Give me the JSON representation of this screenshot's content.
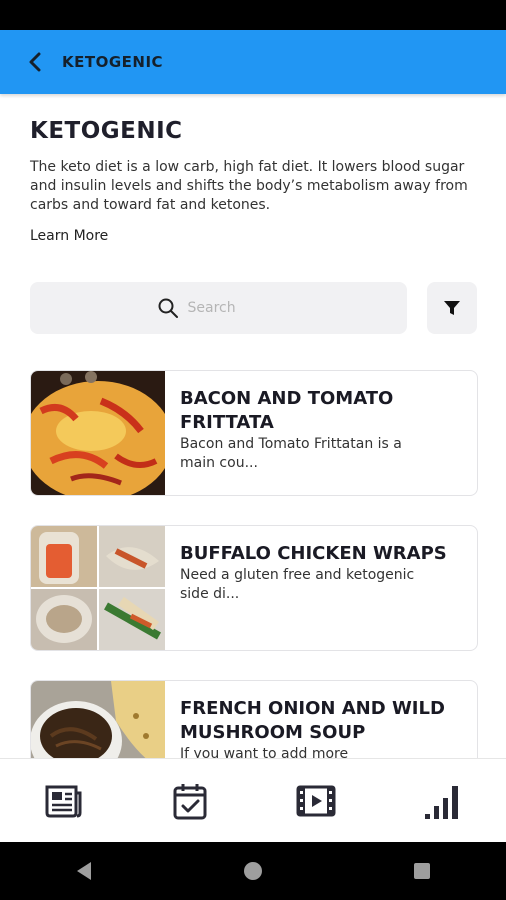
{
  "appbar": {
    "title": "KETOGENIC",
    "back_icon": "arrow-back-icon"
  },
  "page": {
    "title": "KETOGENIC",
    "description": "The keto diet is a low carb, high fat diet. It lowers blood sugar and insulin levels and shifts the body’s metabolism away from carbs and toward fat and ketones.",
    "learn_more": "Learn More"
  },
  "search": {
    "placeholder": "Search",
    "icon": "search-icon"
  },
  "filter": {
    "icon": "filter-icon"
  },
  "recipes": [
    {
      "title": "BACON AND TOMATO FRITTATA",
      "description": "Bacon and Tomato Frittatan is a main cou..."
    },
    {
      "title": "BUFFALO CHICKEN WRAPS",
      "description": "Need a gluten free and ketogenic side di..."
    },
    {
      "title": "FRENCH ONION AND WILD MUSHROOM SOUP",
      "description": "If you want to add more"
    }
  ],
  "bottom_nav": [
    "newspaper-icon",
    "calendar-check-icon",
    "video-icon",
    "bar-chart-icon"
  ],
  "system_nav": [
    "back-triangle-icon",
    "home-circle-icon",
    "recents-square-icon"
  ],
  "colors": {
    "appbar": "#2196f3",
    "text": "#1f1f2b",
    "surface": "#f1f1f3"
  }
}
